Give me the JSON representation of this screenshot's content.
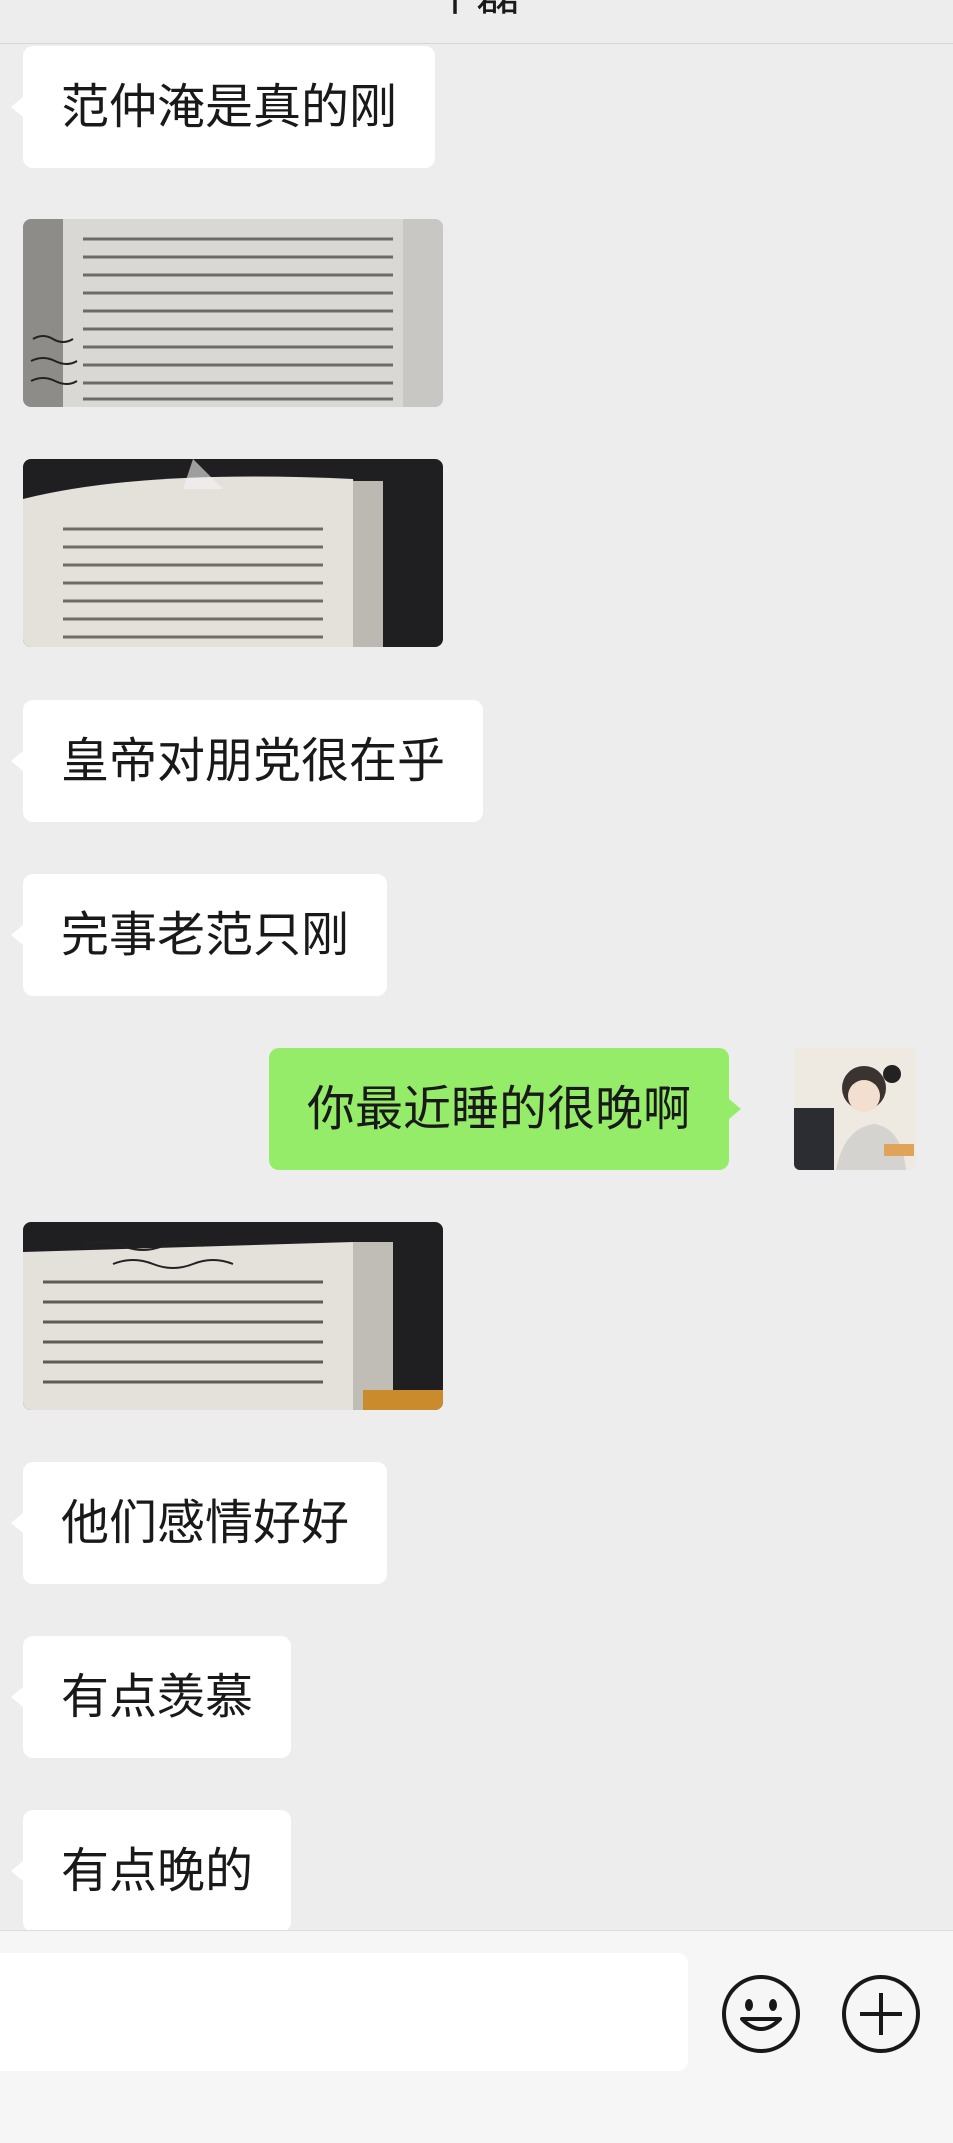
{
  "header": {
    "title": "牛磊"
  },
  "messages": [
    {
      "type": "text",
      "side": "left",
      "text": "范仲淹是真的刚"
    },
    {
      "type": "image",
      "side": "left",
      "description_icon": "book-photo"
    },
    {
      "type": "image",
      "side": "left",
      "description_icon": "book-photo"
    },
    {
      "type": "text",
      "side": "left",
      "text": "皇帝对朋党很在乎"
    },
    {
      "type": "text",
      "side": "left",
      "text": "完事老范只刚"
    },
    {
      "type": "text",
      "side": "right",
      "text": "你最近睡的很晚啊"
    },
    {
      "type": "image",
      "side": "left",
      "description_icon": "book-photo"
    },
    {
      "type": "text",
      "side": "left",
      "text": "他们感情好好"
    },
    {
      "type": "text",
      "side": "left",
      "text": "有点羡慕"
    },
    {
      "type": "text",
      "side": "left",
      "text": "有点晚的"
    }
  ],
  "input": {
    "value": "",
    "placeholder": ""
  },
  "icons": {
    "emoji": "emoji-icon",
    "plus": "plus-icon"
  },
  "colors": {
    "background": "#ededed",
    "bubble_left": "#ffffff",
    "bubble_right": "#95ec69",
    "icon_stroke": "#181818"
  }
}
